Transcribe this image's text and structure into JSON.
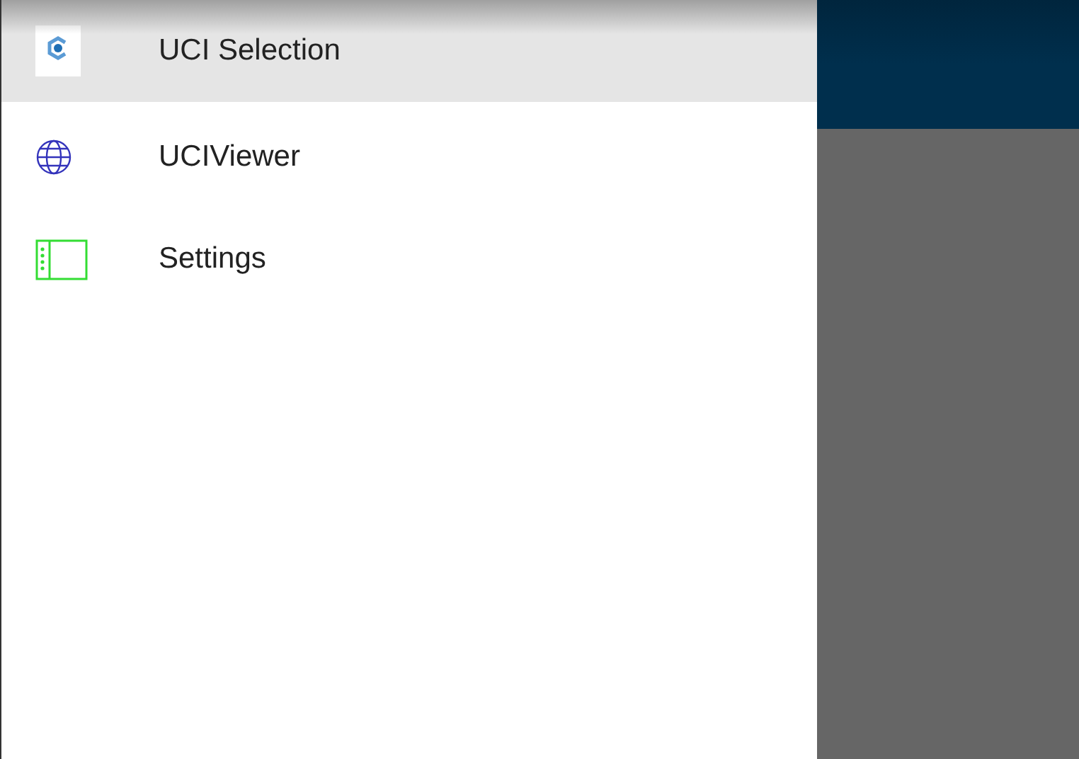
{
  "drawer": {
    "items": [
      {
        "label": "UCI Selection",
        "selected": true
      },
      {
        "label": "UCIViewer",
        "selected": false
      },
      {
        "label": "Settings",
        "selected": false
      }
    ]
  }
}
